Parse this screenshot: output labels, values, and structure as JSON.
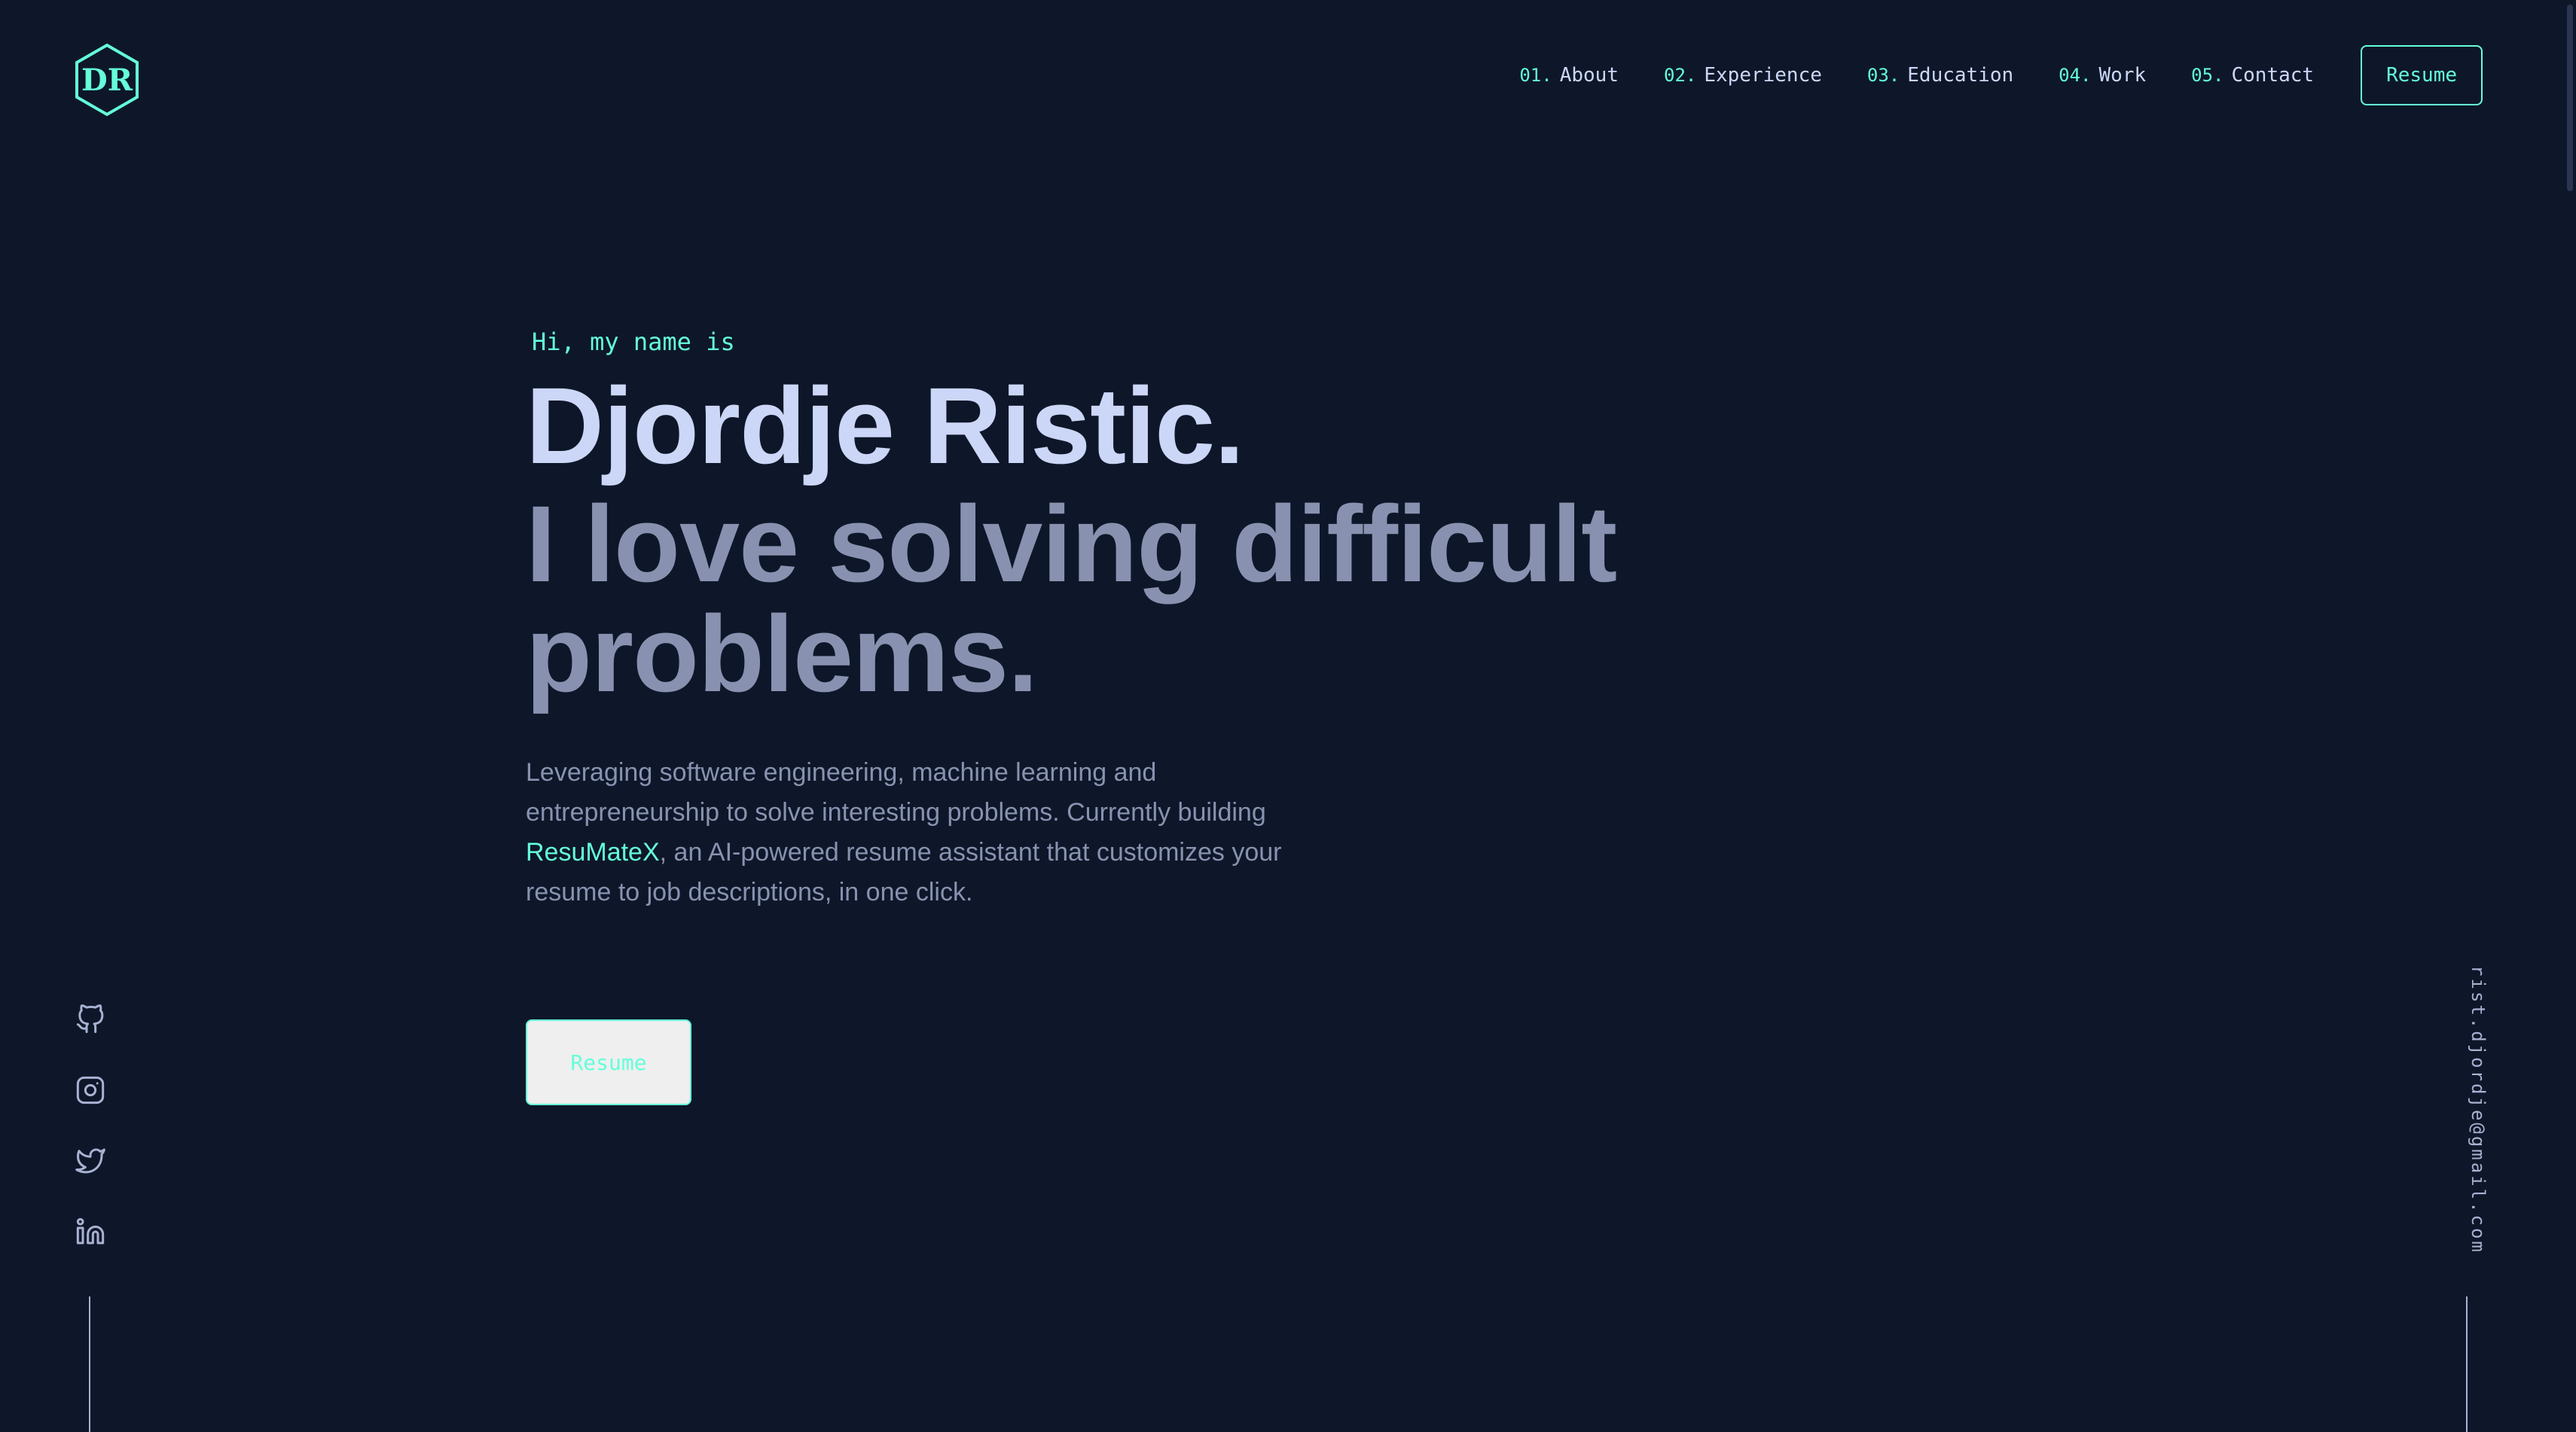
{
  "header": {
    "logo_letter": "DR",
    "nav": [
      {
        "num": "01.",
        "label": "About"
      },
      {
        "num": "02.",
        "label": "Experience"
      },
      {
        "num": "03.",
        "label": "Education"
      },
      {
        "num": "04.",
        "label": "Work"
      },
      {
        "num": "05.",
        "label": "Contact"
      }
    ],
    "resume_label": "Resume"
  },
  "hero": {
    "greeting": "Hi, my name is",
    "name": "Djordje Ristic.",
    "tagline": "I love solving difficult problems.",
    "desc_before": "Leveraging software engineering, machine learning and entrepreneurship to solve interesting problems. Currently building ",
    "desc_link": "ResuMateX",
    "desc_after": ", an AI-powered resume assistant that customizes your resume to job descriptions, in one click.",
    "resume_label": "Resume"
  },
  "sidebar_left": {
    "socials": [
      "github-icon",
      "instagram-icon",
      "twitter-icon",
      "linkedin-icon"
    ]
  },
  "sidebar_right": {
    "email": "rist.djordje@gmail.com"
  },
  "colors": {
    "background": "#0e1729",
    "accent": "#64ffda",
    "heading": "#ccd6f6",
    "text": "#8892b0"
  }
}
